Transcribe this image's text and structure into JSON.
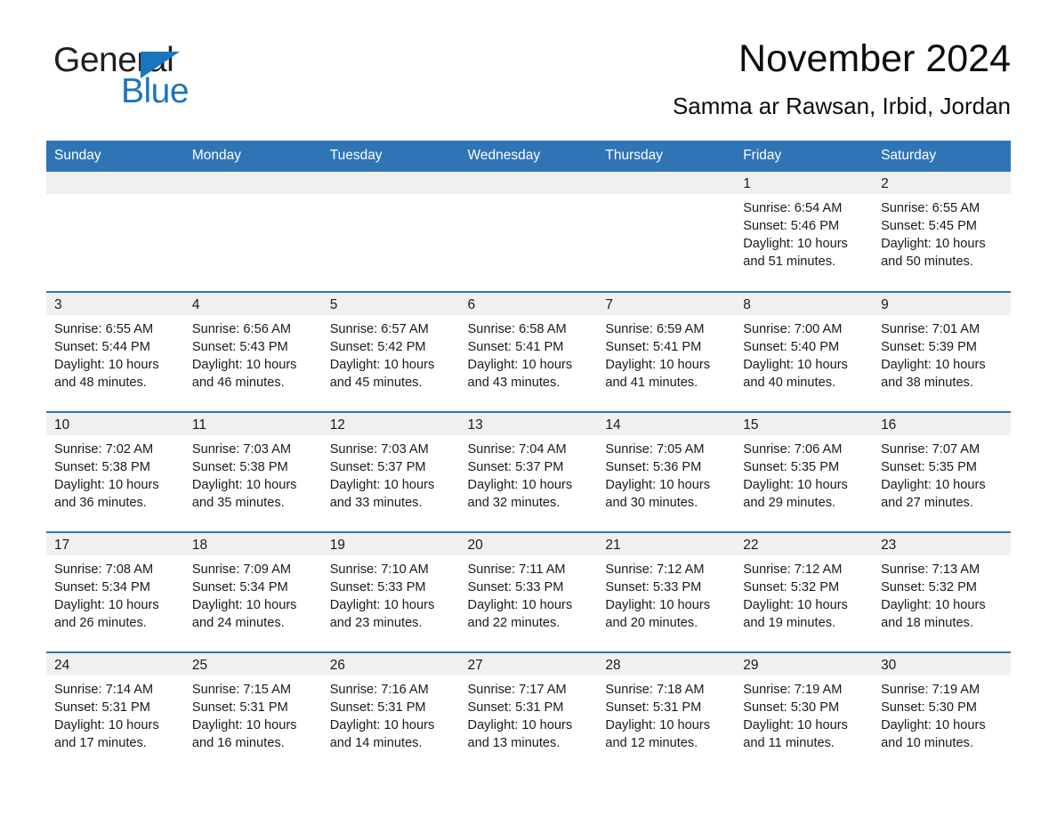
{
  "brand": {
    "name_part1": "General",
    "name_part2": "Blue",
    "triangle_color": "#1a75bc",
    "text_color": "#231f20"
  },
  "header": {
    "title": "November 2024",
    "subtitle": "Samma ar Rawsan, Irbid, Jordan"
  },
  "theme": {
    "header_blue": "#2f74b5",
    "daynum_band": "#f0f0f0",
    "row_rule": "#2f74b5"
  },
  "weekday_headers": [
    "Sunday",
    "Monday",
    "Tuesday",
    "Wednesday",
    "Thursday",
    "Friday",
    "Saturday"
  ],
  "weeks": [
    [
      {
        "day": "",
        "sunrise": "",
        "sunset": "",
        "daylight_line1": "",
        "daylight_line2": ""
      },
      {
        "day": "",
        "sunrise": "",
        "sunset": "",
        "daylight_line1": "",
        "daylight_line2": ""
      },
      {
        "day": "",
        "sunrise": "",
        "sunset": "",
        "daylight_line1": "",
        "daylight_line2": ""
      },
      {
        "day": "",
        "sunrise": "",
        "sunset": "",
        "daylight_line1": "",
        "daylight_line2": ""
      },
      {
        "day": "",
        "sunrise": "",
        "sunset": "",
        "daylight_line1": "",
        "daylight_line2": ""
      },
      {
        "day": "1",
        "sunrise": "Sunrise: 6:54 AM",
        "sunset": "Sunset: 5:46 PM",
        "daylight_line1": "Daylight: 10 hours",
        "daylight_line2": "and 51 minutes."
      },
      {
        "day": "2",
        "sunrise": "Sunrise: 6:55 AM",
        "sunset": "Sunset: 5:45 PM",
        "daylight_line1": "Daylight: 10 hours",
        "daylight_line2": "and 50 minutes."
      }
    ],
    [
      {
        "day": "3",
        "sunrise": "Sunrise: 6:55 AM",
        "sunset": "Sunset: 5:44 PM",
        "daylight_line1": "Daylight: 10 hours",
        "daylight_line2": "and 48 minutes."
      },
      {
        "day": "4",
        "sunrise": "Sunrise: 6:56 AM",
        "sunset": "Sunset: 5:43 PM",
        "daylight_line1": "Daylight: 10 hours",
        "daylight_line2": "and 46 minutes."
      },
      {
        "day": "5",
        "sunrise": "Sunrise: 6:57 AM",
        "sunset": "Sunset: 5:42 PM",
        "daylight_line1": "Daylight: 10 hours",
        "daylight_line2": "and 45 minutes."
      },
      {
        "day": "6",
        "sunrise": "Sunrise: 6:58 AM",
        "sunset": "Sunset: 5:41 PM",
        "daylight_line1": "Daylight: 10 hours",
        "daylight_line2": "and 43 minutes."
      },
      {
        "day": "7",
        "sunrise": "Sunrise: 6:59 AM",
        "sunset": "Sunset: 5:41 PM",
        "daylight_line1": "Daylight: 10 hours",
        "daylight_line2": "and 41 minutes."
      },
      {
        "day": "8",
        "sunrise": "Sunrise: 7:00 AM",
        "sunset": "Sunset: 5:40 PM",
        "daylight_line1": "Daylight: 10 hours",
        "daylight_line2": "and 40 minutes."
      },
      {
        "day": "9",
        "sunrise": "Sunrise: 7:01 AM",
        "sunset": "Sunset: 5:39 PM",
        "daylight_line1": "Daylight: 10 hours",
        "daylight_line2": "and 38 minutes."
      }
    ],
    [
      {
        "day": "10",
        "sunrise": "Sunrise: 7:02 AM",
        "sunset": "Sunset: 5:38 PM",
        "daylight_line1": "Daylight: 10 hours",
        "daylight_line2": "and 36 minutes."
      },
      {
        "day": "11",
        "sunrise": "Sunrise: 7:03 AM",
        "sunset": "Sunset: 5:38 PM",
        "daylight_line1": "Daylight: 10 hours",
        "daylight_line2": "and 35 minutes."
      },
      {
        "day": "12",
        "sunrise": "Sunrise: 7:03 AM",
        "sunset": "Sunset: 5:37 PM",
        "daylight_line1": "Daylight: 10 hours",
        "daylight_line2": "and 33 minutes."
      },
      {
        "day": "13",
        "sunrise": "Sunrise: 7:04 AM",
        "sunset": "Sunset: 5:37 PM",
        "daylight_line1": "Daylight: 10 hours",
        "daylight_line2": "and 32 minutes."
      },
      {
        "day": "14",
        "sunrise": "Sunrise: 7:05 AM",
        "sunset": "Sunset: 5:36 PM",
        "daylight_line1": "Daylight: 10 hours",
        "daylight_line2": "and 30 minutes."
      },
      {
        "day": "15",
        "sunrise": "Sunrise: 7:06 AM",
        "sunset": "Sunset: 5:35 PM",
        "daylight_line1": "Daylight: 10 hours",
        "daylight_line2": "and 29 minutes."
      },
      {
        "day": "16",
        "sunrise": "Sunrise: 7:07 AM",
        "sunset": "Sunset: 5:35 PM",
        "daylight_line1": "Daylight: 10 hours",
        "daylight_line2": "and 27 minutes."
      }
    ],
    [
      {
        "day": "17",
        "sunrise": "Sunrise: 7:08 AM",
        "sunset": "Sunset: 5:34 PM",
        "daylight_line1": "Daylight: 10 hours",
        "daylight_line2": "and 26 minutes."
      },
      {
        "day": "18",
        "sunrise": "Sunrise: 7:09 AM",
        "sunset": "Sunset: 5:34 PM",
        "daylight_line1": "Daylight: 10 hours",
        "daylight_line2": "and 24 minutes."
      },
      {
        "day": "19",
        "sunrise": "Sunrise: 7:10 AM",
        "sunset": "Sunset: 5:33 PM",
        "daylight_line1": "Daylight: 10 hours",
        "daylight_line2": "and 23 minutes."
      },
      {
        "day": "20",
        "sunrise": "Sunrise: 7:11 AM",
        "sunset": "Sunset: 5:33 PM",
        "daylight_line1": "Daylight: 10 hours",
        "daylight_line2": "and 22 minutes."
      },
      {
        "day": "21",
        "sunrise": "Sunrise: 7:12 AM",
        "sunset": "Sunset: 5:33 PM",
        "daylight_line1": "Daylight: 10 hours",
        "daylight_line2": "and 20 minutes."
      },
      {
        "day": "22",
        "sunrise": "Sunrise: 7:12 AM",
        "sunset": "Sunset: 5:32 PM",
        "daylight_line1": "Daylight: 10 hours",
        "daylight_line2": "and 19 minutes."
      },
      {
        "day": "23",
        "sunrise": "Sunrise: 7:13 AM",
        "sunset": "Sunset: 5:32 PM",
        "daylight_line1": "Daylight: 10 hours",
        "daylight_line2": "and 18 minutes."
      }
    ],
    [
      {
        "day": "24",
        "sunrise": "Sunrise: 7:14 AM",
        "sunset": "Sunset: 5:31 PM",
        "daylight_line1": "Daylight: 10 hours",
        "daylight_line2": "and 17 minutes."
      },
      {
        "day": "25",
        "sunrise": "Sunrise: 7:15 AM",
        "sunset": "Sunset: 5:31 PM",
        "daylight_line1": "Daylight: 10 hours",
        "daylight_line2": "and 16 minutes."
      },
      {
        "day": "26",
        "sunrise": "Sunrise: 7:16 AM",
        "sunset": "Sunset: 5:31 PM",
        "daylight_line1": "Daylight: 10 hours",
        "daylight_line2": "and 14 minutes."
      },
      {
        "day": "27",
        "sunrise": "Sunrise: 7:17 AM",
        "sunset": "Sunset: 5:31 PM",
        "daylight_line1": "Daylight: 10 hours",
        "daylight_line2": "and 13 minutes."
      },
      {
        "day": "28",
        "sunrise": "Sunrise: 7:18 AM",
        "sunset": "Sunset: 5:31 PM",
        "daylight_line1": "Daylight: 10 hours",
        "daylight_line2": "and 12 minutes."
      },
      {
        "day": "29",
        "sunrise": "Sunrise: 7:19 AM",
        "sunset": "Sunset: 5:30 PM",
        "daylight_line1": "Daylight: 10 hours",
        "daylight_line2": "and 11 minutes."
      },
      {
        "day": "30",
        "sunrise": "Sunrise: 7:19 AM",
        "sunset": "Sunset: 5:30 PM",
        "daylight_line1": "Daylight: 10 hours",
        "daylight_line2": "and 10 minutes."
      }
    ]
  ]
}
